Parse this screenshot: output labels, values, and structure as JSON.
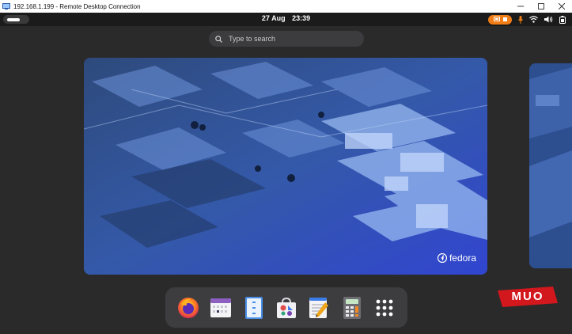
{
  "window": {
    "title": "192.168.1.199 - Remote Desktop Connection"
  },
  "topbar": {
    "date": "27 Aug",
    "time": "23:39"
  },
  "search": {
    "placeholder": "Type to search"
  },
  "workspace": {
    "brand": "fedora"
  },
  "dash": {
    "apps": [
      {
        "name": "Firefox",
        "icon": "firefox-icon"
      },
      {
        "name": "Calendar",
        "icon": "calendar-icon"
      },
      {
        "name": "Files",
        "icon": "files-icon"
      },
      {
        "name": "Software",
        "icon": "software-icon"
      },
      {
        "name": "Text Editor",
        "icon": "text-editor-icon"
      },
      {
        "name": "Calculator",
        "icon": "calculator-icon"
      },
      {
        "name": "Show Apps",
        "icon": "app-grid-icon"
      }
    ]
  },
  "watermark": {
    "text": "MUO"
  },
  "colors": {
    "privacy_indicator": "#f07d15",
    "mic_indicator": "#f07d15",
    "panel": "#1b1b1b",
    "overview_bg": "#2a2a2b"
  }
}
